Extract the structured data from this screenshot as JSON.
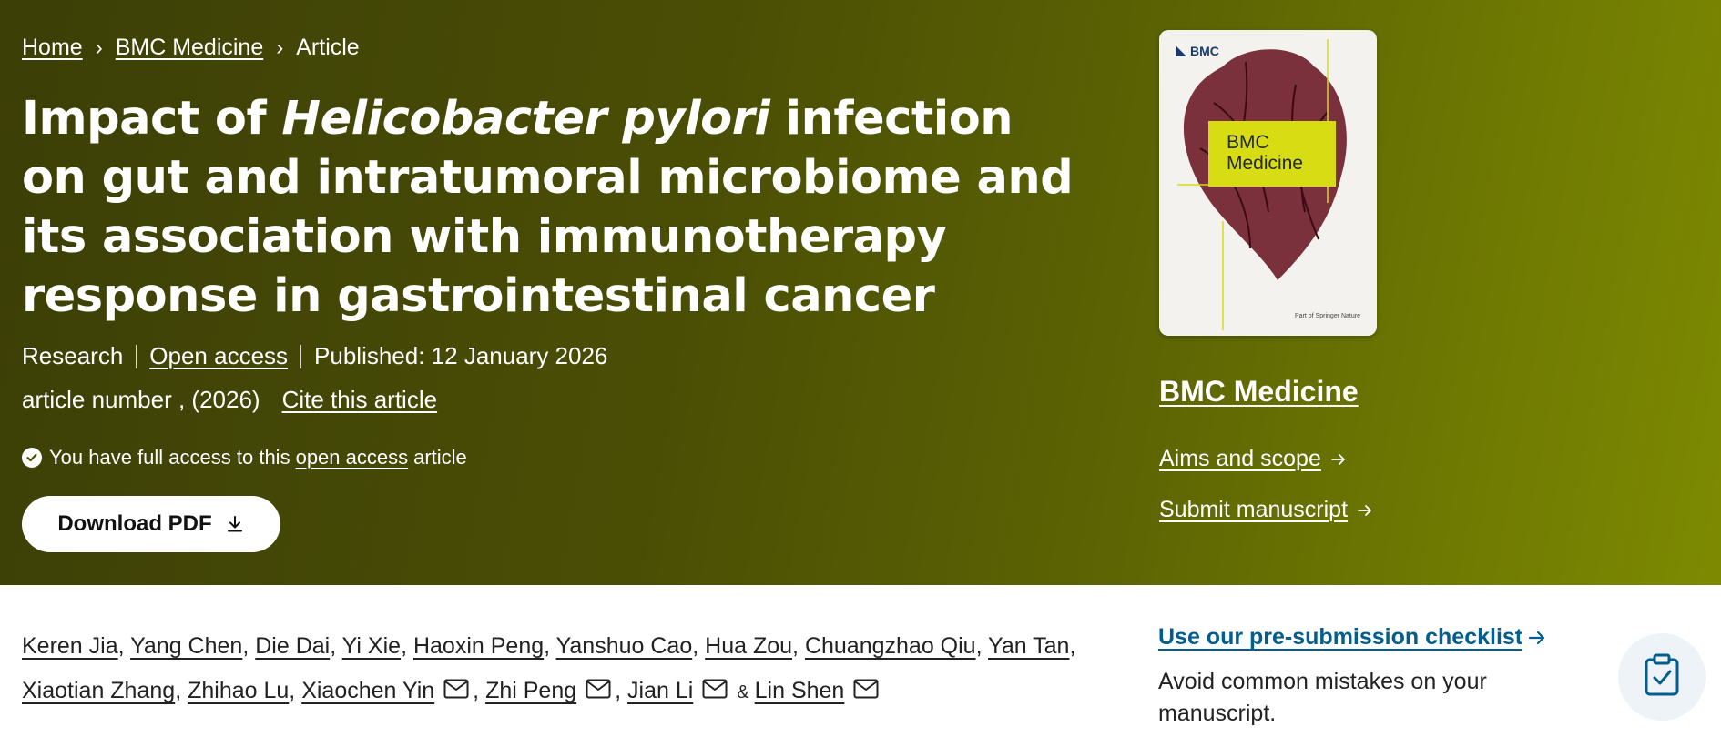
{
  "breadcrumb": {
    "home": "Home",
    "journal": "BMC Medicine",
    "current": "Article"
  },
  "article": {
    "title_pre": "Impact of ",
    "title_italic": "Helicobacter pylori",
    "title_post": " infection on gut and intratumoral microbiome and its association with immunotherapy response in gastrointestinal cancer",
    "type": "Research",
    "open_access": "Open access",
    "published": "Published: 12 January 2026",
    "article_number": "article number , (2026)",
    "cite": "Cite this article",
    "access_pre": "You have full access to this",
    "access_link": "open access",
    "access_post": "article",
    "download": "Download PDF"
  },
  "sidebar": {
    "cover_logo": "BMC",
    "cover_title_1": "BMC",
    "cover_title_2": "Medicine",
    "cover_footer": "Part of Springer Nature",
    "journal_name": "BMC Medicine",
    "aims": "Aims and scope",
    "submit": "Submit manuscript",
    "checklist": "Use our pre-submission checklist",
    "checklist_desc": "Avoid common mistakes on your manuscript."
  },
  "authors": [
    {
      "name": "Keren Jia",
      "sep": ", ",
      "mail": false
    },
    {
      "name": "Yang Chen",
      "sep": ", ",
      "mail": false
    },
    {
      "name": "Die Dai",
      "sep": ", ",
      "mail": false
    },
    {
      "name": "Yi Xie",
      "sep": ", ",
      "mail": false
    },
    {
      "name": "Haoxin Peng",
      "sep": ", ",
      "mail": false
    },
    {
      "name": "Yanshuo Cao",
      "sep": ", ",
      "mail": false
    },
    {
      "name": "Hua Zou",
      "sep": ", ",
      "mail": false
    },
    {
      "name": "Chuangzhao Qiu",
      "sep": ", ",
      "mail": false
    },
    {
      "name": "Yan Tan",
      "sep": ", ",
      "mail": false
    },
    {
      "name": "Xiaotian Zhang",
      "sep": ", ",
      "mail": false
    },
    {
      "name": "Zhihao Lu",
      "sep": ", ",
      "mail": false
    },
    {
      "name": "Xiaochen Yin",
      "sep": ", ",
      "mail": true
    },
    {
      "name": "Zhi Peng",
      "sep": ", ",
      "mail": true
    },
    {
      "name": "Jian Li",
      "sep": "",
      "mail": true
    },
    {
      "name": "Lin Shen",
      "sep": "",
      "mail": true
    }
  ],
  "authors_amp": "&",
  "colors": {
    "hero_dark": "#3c3f06",
    "hero_light": "#7d8a01",
    "link_blue": "#025e8d",
    "cover_label": "#d7dd12"
  }
}
